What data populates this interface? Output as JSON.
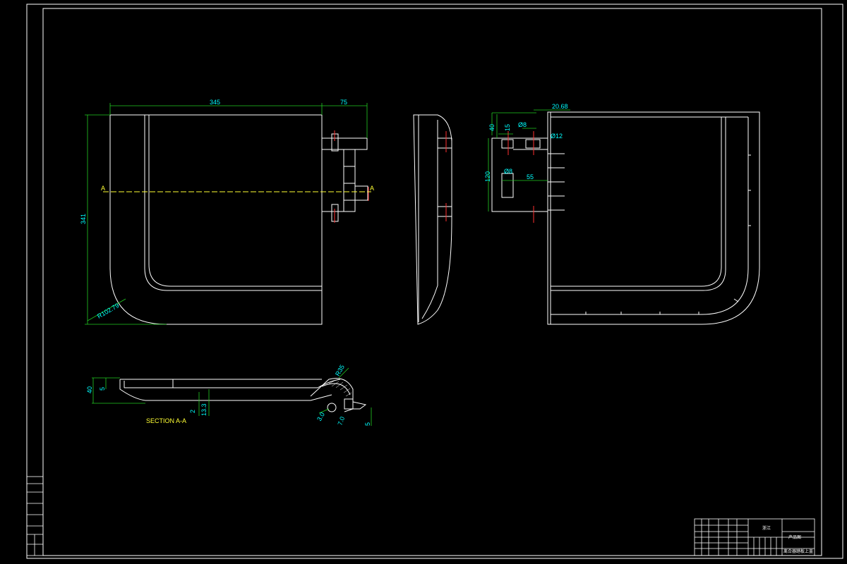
{
  "section_label": "SECTION A-A",
  "section_marker": "A",
  "front_view_dims": {
    "width": "345",
    "tab": "75",
    "height": "341",
    "radius": "R102.79"
  },
  "right_view_dims": {
    "offset": "20.68",
    "d40": "40",
    "d15": "15",
    "phi8_top": "Ø8",
    "phi12": "Ø12",
    "d120": "120",
    "phi8": "Ø8",
    "d55": "55"
  },
  "section_dims": {
    "d40": "40",
    "d5": "5",
    "d2": "2",
    "d133": "13.3",
    "r": "R35",
    "d30": "3.0",
    "d70": "7.0",
    "d5b": "5"
  },
  "title_block": {
    "company": "浙江",
    "product_name": "产品图",
    "part_name": "离合器踏板上盖"
  },
  "colors": {
    "background": "#000000",
    "line": "#ffffff",
    "dimension": "#00ffff",
    "dim_line": "#22cc22",
    "center": "#ffff00",
    "hidden": "#ff3030"
  }
}
